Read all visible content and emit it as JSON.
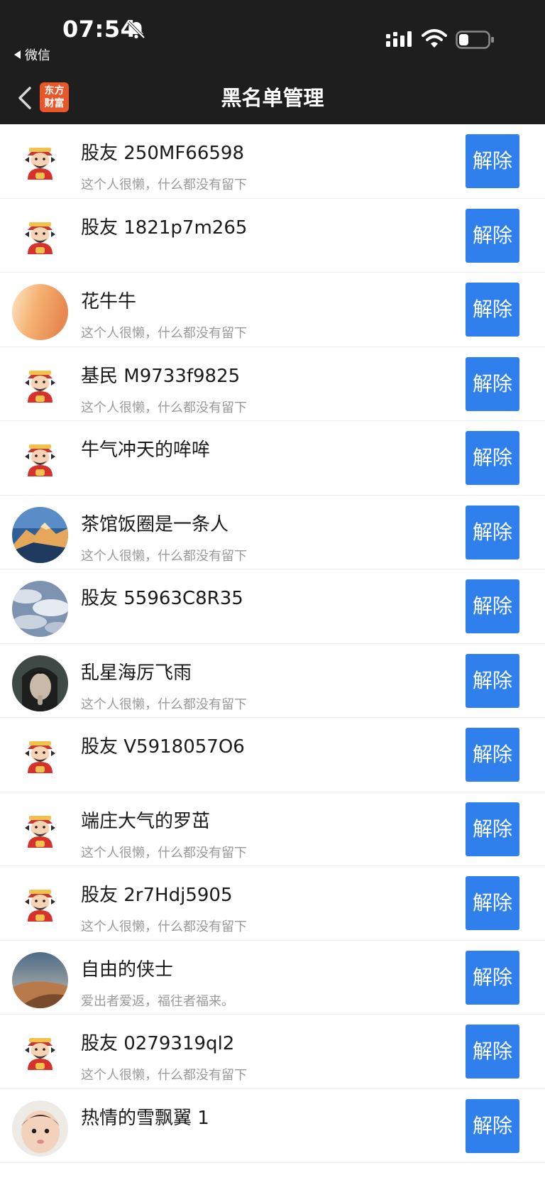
{
  "status_bar": {
    "time": "07:54",
    "back_app": "微信",
    "icons": [
      "bell-off-icon",
      "signal-icon",
      "wifi-icon",
      "battery-icon"
    ]
  },
  "nav": {
    "title": "黑名单管理",
    "logo_line1": "东方",
    "logo_line2": "财富",
    "back_icon": "chevron-left-icon"
  },
  "colors": {
    "header_bg": "#1e1e1e",
    "button_bg": "#2f80ed",
    "logo_bg": "#e8572a",
    "bio_text": "#9a9a9a"
  },
  "button_label": "解除",
  "users": [
    {
      "name": "股友 250MF66598",
      "bio": "这个人很懒，什么都没有留下",
      "avatar": "god-of-wealth"
    },
    {
      "name": "股友 1821p7m265",
      "bio": "",
      "avatar": "god-of-wealth"
    },
    {
      "name": "花牛牛",
      "bio": "这个人很懒，什么都没有留下",
      "avatar": "gradient-orange"
    },
    {
      "name": "基民 M9733f9825",
      "bio": "这个人很懒，什么都没有留下",
      "avatar": "god-of-wealth"
    },
    {
      "name": "牛气冲天的哞哞",
      "bio": "",
      "avatar": "god-of-wealth"
    },
    {
      "name": "茶馆饭圈是一条人",
      "bio": "这个人很懒，什么都没有留下",
      "avatar": "mountain-photo"
    },
    {
      "name": "股友 55963C8R35",
      "bio": "",
      "avatar": "clouds-photo"
    },
    {
      "name": "乱星海厉飞雨",
      "bio": "这个人很懒，什么都没有留下",
      "avatar": "portrait-photo"
    },
    {
      "name": "股友 V5918057O6",
      "bio": "",
      "avatar": "god-of-wealth"
    },
    {
      "name": "端庄大气的罗茁",
      "bio": "这个人很懒，什么都没有留下",
      "avatar": "god-of-wealth"
    },
    {
      "name": "股友 2r7Hdj5905",
      "bio": "这个人很懒，什么都没有留下",
      "avatar": "god-of-wealth"
    },
    {
      "name": "自由的侠士",
      "bio": "爱出者爱返，福往者福来。",
      "avatar": "desert-photo"
    },
    {
      "name": "股友 0279319ql2",
      "bio": "这个人很懒，什么都没有留下",
      "avatar": "god-of-wealth"
    },
    {
      "name": "热情的雪飘翼 1",
      "bio": "",
      "avatar": "baby-photo"
    }
  ]
}
